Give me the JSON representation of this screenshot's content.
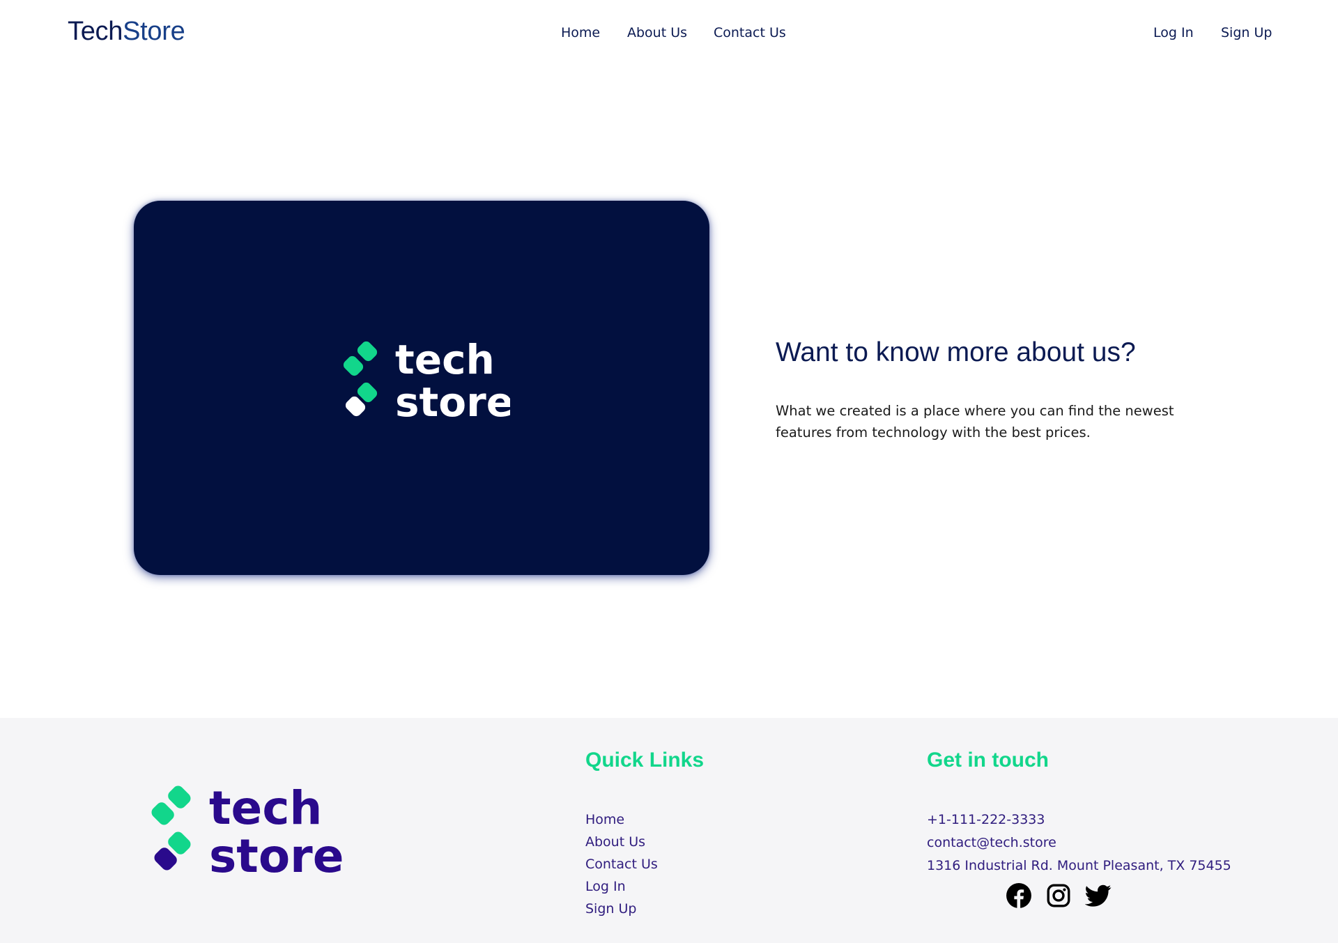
{
  "header": {
    "brand": {
      "part1": "Tech",
      "part2": "Store"
    },
    "nav": [
      {
        "label": "Home"
      },
      {
        "label": "About Us"
      },
      {
        "label": "Contact Us"
      }
    ],
    "auth": {
      "login": "Log In",
      "signup": "Sign Up"
    }
  },
  "hero": {
    "logo": {
      "line1": "tech",
      "line2": "store"
    },
    "title": "Want to know more about us?",
    "text": "What we created is a place where you can find the newest features from technology with the best prices."
  },
  "footer": {
    "logo": {
      "line1": "tech",
      "line2": "store"
    },
    "quick_links": {
      "heading": "Quick Links",
      "items": [
        {
          "label": "Home"
        },
        {
          "label": "About Us"
        },
        {
          "label": "Contact Us"
        },
        {
          "label": "Log In"
        },
        {
          "label": "Sign Up"
        }
      ]
    },
    "contact": {
      "heading": "Get in touch",
      "phone": "+1-111-222-3333",
      "email": "contact@tech.store",
      "address": "1316 Industrial Rd. Mount Pleasant, TX 75455"
    },
    "socials": [
      "facebook-icon",
      "instagram-icon",
      "twitter-icon"
    ]
  },
  "colors": {
    "navy": "#02103f",
    "brand_text": "#0b1a52",
    "accent_green": "#12d68b",
    "footer_purple": "#2f1c7e",
    "footer_bg": "#f5f5f7"
  }
}
